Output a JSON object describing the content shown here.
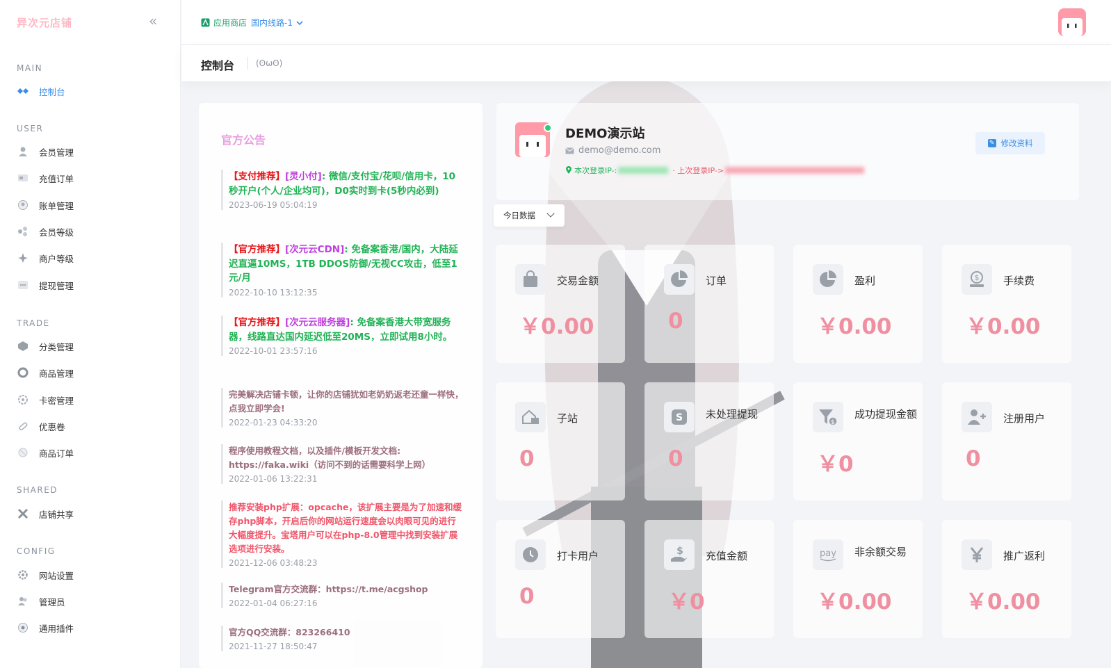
{
  "sidebar": {
    "brand": "异次元店铺",
    "collapse_icon": "double-chevron-left-icon",
    "sections": {
      "main": "MAIN",
      "user": "USER",
      "trade": "TRADE",
      "shared": "SHARED",
      "config": "CONFIG"
    },
    "items": {
      "dashboard": "控制台",
      "members": "会员管理",
      "recharge_orders": "充值订单",
      "bills": "账单管理",
      "member_levels": "会员等级",
      "merchant_levels": "商户等级",
      "withdraw": "提现管理",
      "categories": "分类管理",
      "products": "商品管理",
      "card_keys": "卡密管理",
      "coupons": "优惠卷",
      "product_orders": "商品订单",
      "store_share": "店铺共享",
      "site_settings": "网站设置",
      "admins": "管理员",
      "plugins": "通用插件"
    }
  },
  "header": {
    "app_store": "应用商店",
    "route": "国内线路-1",
    "page_title": "控制台",
    "face": "(ʘωʘ)"
  },
  "notice": {
    "title": "官方公告",
    "items": [
      {
        "tag1": "【支付推荐】",
        "tag2": "[灵小付]",
        "body": ": 微信/支付宝/花呗/信用卡，10秒开户(个人/企业均可)，D0实时到卡(5秒内必到)",
        "date": "2023-06-19 05:04:19"
      },
      {
        "tag1": "【官方推荐】",
        "tag2": "[次元云CDN]",
        "body": ": 免备案香港/国内，大陆延迟直逼10MS，1TB DDOS防御/无视CC攻击，低至1元/月",
        "date": "2022-10-10 13:12:35"
      },
      {
        "tag1": "【官方推荐】",
        "tag2": "[次元云服务器]",
        "body": ": 免备案香港大带宽服务器，线路直达国内延迟低至20MS，立即试用8小时。",
        "date": "2022-10-01 23:57:16"
      },
      {
        "body": "完美解决店铺卡顿，让你的店铺犹如老奶奶返老还童一样快，点我立即学会!",
        "date": "2022-01-23 04:33:20"
      },
      {
        "body": "程序使用教程文档，以及插件/模板开发文档: https://faka.wiki（访问不到的话需要科学上网）",
        "date": "2022-01-06 13:22:31"
      },
      {
        "body": "推荐安装php扩展：opcache，该扩展主要是为了加速和缓存php脚本，开启后你的网站运行速度会以肉眼可见的进行大幅度提升。宝塔用户可以在php-8.0管理中找到安装扩展选项进行安装。",
        "date": "2021-12-06 03:48:23"
      },
      {
        "body": "Telegram官方交流群：https://t.me/acgshop",
        "date": "2022-01-04 06:27:16"
      },
      {
        "body": "官方QQ交流群：823266410",
        "date": "2021-11-27 18:50:47"
      }
    ]
  },
  "profile": {
    "name": "DEMO演示站",
    "email": "demo@demo.com",
    "ip_current_label": "本次登录IP-:",
    "ip_last_label": "· 上次登录IP->",
    "edit_label": "修改资料"
  },
  "filter": {
    "label": "今日数据"
  },
  "stats": [
    {
      "label": "交易金额",
      "value": "￥0.00",
      "icon": "shopping-bag-icon"
    },
    {
      "label": "订单",
      "value": "0",
      "icon": "pie-chart-icon"
    },
    {
      "label": "盈利",
      "value": "￥0.00",
      "icon": "pie-chart-icon"
    },
    {
      "label": "手续费",
      "value": "￥0.00",
      "icon": "coin-hand-icon"
    },
    {
      "label": "子站",
      "value": "0",
      "icon": "house-icon"
    },
    {
      "label": "未处理提现",
      "value": "0",
      "icon": "dollar-card-icon"
    },
    {
      "label": "成功提现金额",
      "value": "￥0",
      "icon": "funnel-dollar-icon"
    },
    {
      "label": "注册用户",
      "value": "0",
      "icon": "user-plus-icon"
    },
    {
      "label": "打卡用户",
      "value": "0",
      "icon": "clock-icon"
    },
    {
      "label": "充值金额",
      "value": "￥0",
      "icon": "hand-dollar-icon"
    },
    {
      "label": "非余额交易",
      "value": "￥0.00",
      "icon": "pay-icon"
    },
    {
      "label": "推广返利",
      "value": "￥0.00",
      "icon": "yen-icon"
    }
  ],
  "colors": {
    "accent_blue": "#3a8ee6",
    "stat_value": "#ef8fa0",
    "brand_pink": "#ffb8c4"
  }
}
